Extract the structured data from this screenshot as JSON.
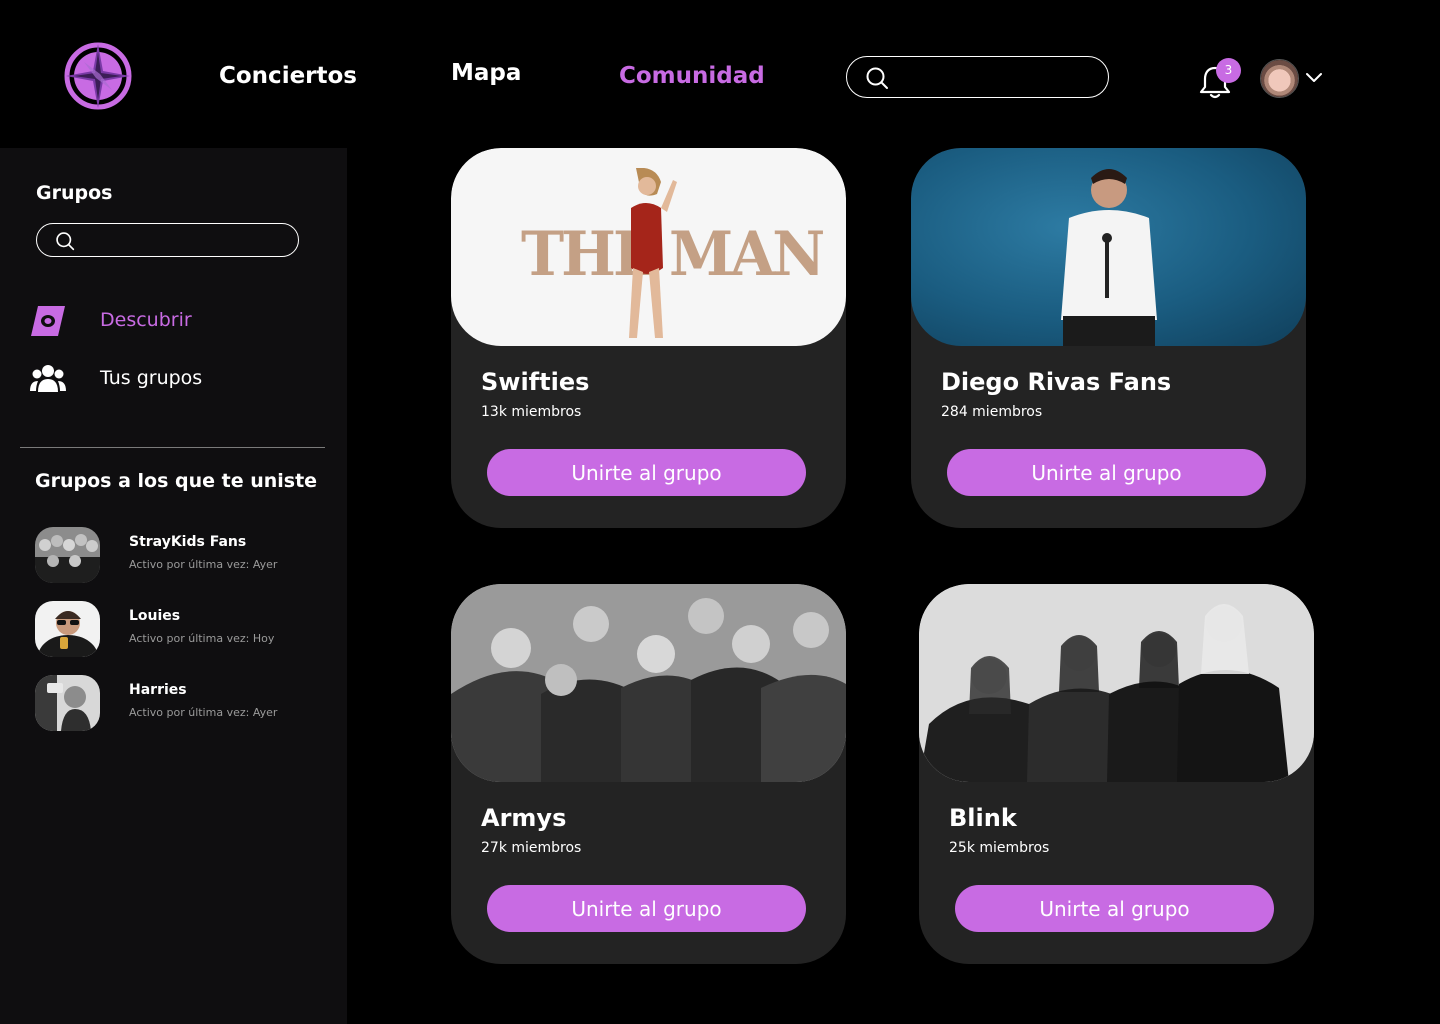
{
  "nav": {
    "links": [
      {
        "label": "Conciertos",
        "active": false
      },
      {
        "label": "Mapa",
        "active": false
      },
      {
        "label": "Comunidad",
        "active": true
      }
    ],
    "search": {
      "placeholder": ""
    },
    "notifications": {
      "count": "3"
    },
    "accent_color": "#c86be3"
  },
  "sidebar": {
    "title": "Grupos",
    "search": {
      "placeholder": ""
    },
    "menu": [
      {
        "label": "Descubrir",
        "icon": "compass-icon",
        "active": true
      },
      {
        "label": "Tus grupos",
        "icon": "people-icon",
        "active": false
      }
    ],
    "joined_title": "Grupos a los que te uniste",
    "joined": [
      {
        "name": "StrayKids Fans",
        "status": "Activo por última vez: Ayer"
      },
      {
        "name": "Louies",
        "status": "Activo por última vez: Hoy"
      },
      {
        "name": "Harries",
        "status": "Activo por última vez: Ayer"
      }
    ]
  },
  "cards": [
    {
      "name": "Swifties",
      "members": "13k miembros",
      "button": "Unirte al grupo",
      "image_text": [
        "THE",
        "MAN"
      ]
    },
    {
      "name": "Diego Rivas Fans",
      "members": "284 miembros",
      "button": "Unirte al grupo"
    },
    {
      "name": "Armys",
      "members": "27k miembros",
      "button": "Unirte al grupo"
    },
    {
      "name": "Blink",
      "members": "25k miembros",
      "button": "Unirte al grupo"
    }
  ]
}
